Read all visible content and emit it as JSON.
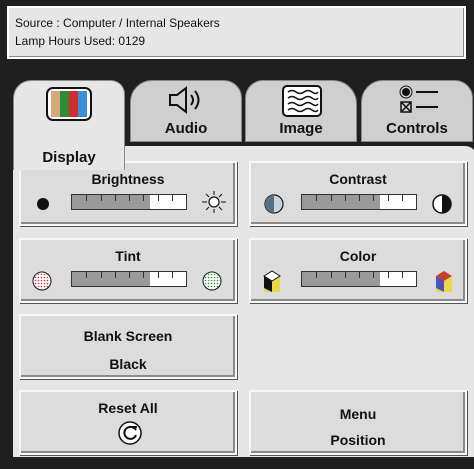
{
  "status": {
    "source_line": "Source : Computer / Internal Speakers",
    "lamp_line": "Lamp Hours Used: 0129"
  },
  "tabs": [
    {
      "label": "Display",
      "icon": "color-bars-icon",
      "selected": true
    },
    {
      "label": "Audio",
      "icon": "speaker-icon",
      "selected": false
    },
    {
      "label": "Image",
      "icon": "image-wave-icon",
      "selected": false
    },
    {
      "label": "Controls",
      "icon": "controls-list-icon",
      "selected": false
    }
  ],
  "controls": {
    "brightness": {
      "label": "Brightness",
      "level": 0.68
    },
    "contrast": {
      "label": "Contrast",
      "level": 0.68
    },
    "tint": {
      "label": "Tint",
      "level": 0.68
    },
    "color": {
      "label": "Color",
      "level": 0.68
    },
    "blank_screen": {
      "label": "Blank Screen",
      "value": "Black"
    },
    "reset_all": {
      "label": "Reset All",
      "icon": "reset-icon"
    },
    "menu_position": {
      "label_line1": "Menu",
      "label_line2": "Position"
    }
  },
  "colors": {
    "panel_bg": "#e6e6e6",
    "frame_bg": "#1f1f1f",
    "slider_fill": "#9a9a9a"
  }
}
